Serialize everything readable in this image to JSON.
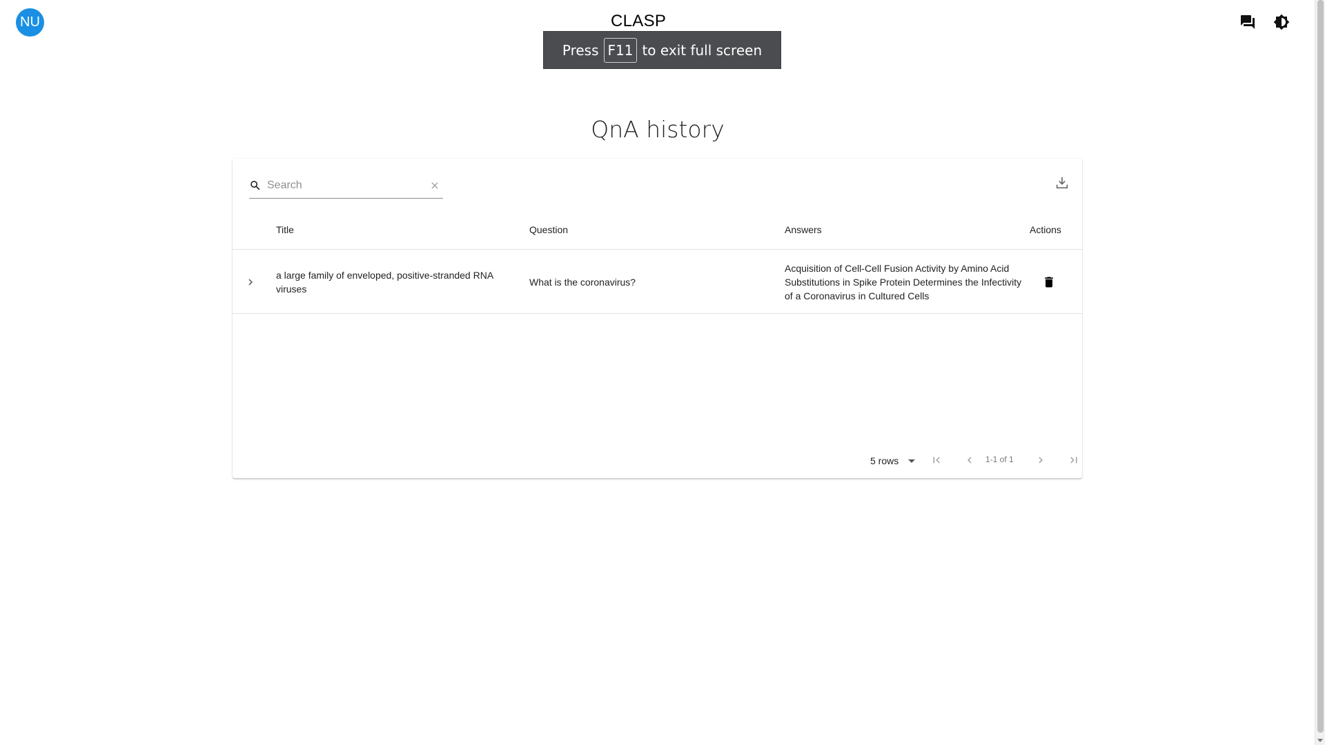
{
  "app": {
    "avatar_initials": "NU",
    "title": "CLASP",
    "avatar_color": "#1a8fe3"
  },
  "header_icons": {
    "chat": "chat-bubbles-icon",
    "theme": "brightness-toggle-icon"
  },
  "fullscreen_toast": {
    "prefix": "Press",
    "key": "F11",
    "suffix": "to exit full screen"
  },
  "page": {
    "heading": "QnA history"
  },
  "table": {
    "search_placeholder": "Search",
    "columns": {
      "title": "Title",
      "question": "Question",
      "answers": "Answers",
      "actions": "Actions"
    },
    "rows": [
      {
        "title": "a large family of enveloped, positive-stranded RNA viruses",
        "question": "What is the coronavirus?",
        "answers": "Acquisition of Cell-Cell Fusion Activity by Amino Acid Substitutions in Spike Protein Determines the Infectivity of a Coronavirus in Cultured Cells"
      }
    ],
    "pagination": {
      "rows_per_page": "5 rows",
      "range_label": "1-1 of 1"
    }
  }
}
